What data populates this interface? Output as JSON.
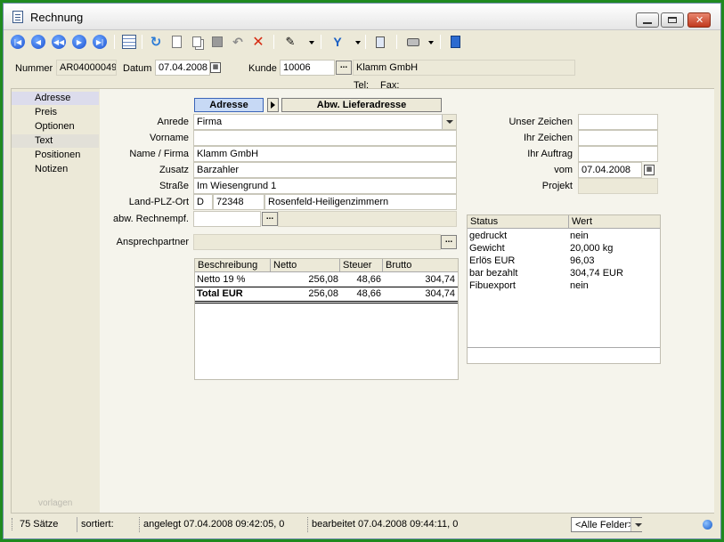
{
  "window": {
    "title": "Rechnung"
  },
  "toolbar": {
    "icons": [
      "first-record-icon",
      "prev-record-icon",
      "prev-page-icon",
      "next-record-icon",
      "last-record-icon",
      "table-view-icon",
      "refresh-icon",
      "new-icon",
      "copy-icon",
      "save-icon",
      "undo-icon",
      "delete-icon",
      "tools-icon",
      "filter-icon",
      "export-icon",
      "print-icon",
      "book-icon"
    ]
  },
  "header": {
    "nummer_label": "Nummer",
    "nummer_value": "AR04000049",
    "datum_label": "Datum",
    "datum_value": "07.04.2008",
    "kunde_label": "Kunde",
    "kunde_value": "10006",
    "kunde_name": "Klamm GmbH",
    "tel_label": "Tel:",
    "fax_label": "Fax:"
  },
  "sidebar": {
    "items": [
      {
        "label": "Adresse"
      },
      {
        "label": "Preis"
      },
      {
        "label": "Optionen"
      },
      {
        "label": "Text"
      },
      {
        "label": "Positionen"
      },
      {
        "label": "Notizen"
      }
    ],
    "watermark": "vorlagen"
  },
  "tabs": {
    "adresse": "Adresse",
    "abw": "Abw. Lieferadresse"
  },
  "address": {
    "anrede_label": "Anrede",
    "anrede_value": "Firma",
    "vorname_label": "Vorname",
    "vorname_value": "",
    "name_label": "Name / Firma",
    "name_value": "Klamm GmbH",
    "zusatz_label": "Zusatz",
    "zusatz_value": "Barzahler",
    "strasse_label": "Straße",
    "strasse_value": "Im Wiesengrund 1",
    "lpo_label": "Land-PLZ-Ort",
    "land": "D",
    "plz": "72348",
    "ort": "Rosenfeld-Heiligenzimmern",
    "abw_label": "abw. Rechnempf.",
    "ansprech_label": "Ansprechpartner"
  },
  "right_fields": {
    "unser_label": "Unser Zeichen",
    "ihr_label": "Ihr Zeichen",
    "auftrag_label": "Ihr Auftrag",
    "vom_label": "vom",
    "vom_value": "07.04.2008",
    "projekt_label": "Projekt"
  },
  "totals_table": {
    "columns": [
      "Beschreibung",
      "Netto",
      "Steuer",
      "Brutto"
    ],
    "rows": [
      {
        "desc": "Netto 19 %",
        "netto": "256,08",
        "steuer": "48,66",
        "brutto": "304,74"
      },
      {
        "desc": "Total EUR",
        "netto": "256,08",
        "steuer": "48,66",
        "brutto": "304,74"
      }
    ]
  },
  "status_table": {
    "columns": [
      "Status",
      "Wert"
    ],
    "rows": [
      {
        "status": "gedruckt",
        "wert": "nein"
      },
      {
        "status": "Gewicht",
        "wert": "20,000 kg"
      },
      {
        "status": "Erlös EUR",
        "wert": "96,03"
      },
      {
        "status": "bar bezahlt",
        "wert": "304,74 EUR"
      },
      {
        "status": "Fibuexport",
        "wert": "nein"
      }
    ]
  },
  "statusbar": {
    "count": "75 Sätze",
    "sorted": "sortiert:",
    "created": "angelegt 07.04.2008 09:42:05,  0",
    "edited": "bearbeitet 07.04.2008 09:44:11,  0",
    "filter": "<Alle Felder>"
  }
}
